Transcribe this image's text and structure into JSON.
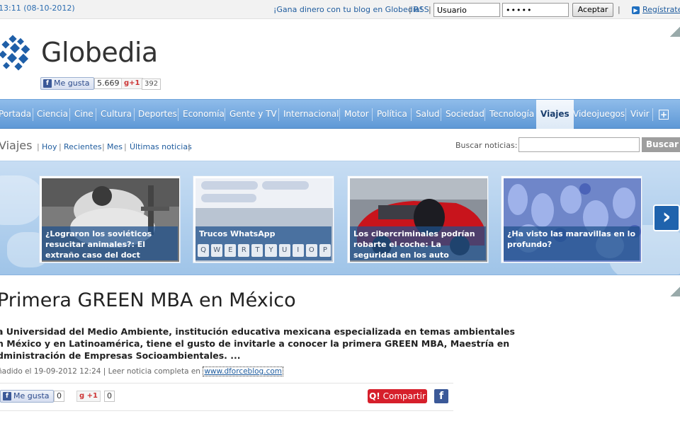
{
  "topbar": {
    "time": "13:11 (08-10-2012)",
    "promo": "¡Gana dinero con tu blog en Globedia!",
    "rss": "RSS",
    "user_value": "Usuario",
    "password_value": "•••••",
    "accept_label": "Aceptar",
    "register_label": "Regístrate"
  },
  "header": {
    "logo_text": "Globedia",
    "fb_like_label": "Me gusta",
    "fb_count": "5.669",
    "gplus_label": "+1",
    "gplus_count": "392"
  },
  "nav": {
    "items": [
      "Portada",
      "Ciencia",
      "Cine",
      "Cultura",
      "Deportes",
      "Economía",
      "Gente y TV",
      "Internacional",
      "Motor",
      "Política",
      "Salud",
      "Sociedad",
      "Tecnología",
      "Viajes",
      "Videojuegos",
      "Vivir"
    ],
    "active": "Viajes",
    "plus": "+"
  },
  "subbar": {
    "section": "Viajes",
    "links": [
      "Hoy",
      "Recientes",
      "Mes",
      "Últimas noticias"
    ],
    "search_label": "Buscar noticias:",
    "search_button": "Buscar"
  },
  "carousel": {
    "cards": [
      {
        "caption": "¿Lograron los soviéticos resucitar animales?: El extraño caso del doct"
      },
      {
        "caption": "Trucos WhatsApp"
      },
      {
        "caption": "Los cibercriminales podrían robarte el coche: La seguridad en los auto"
      },
      {
        "caption": "¿Ha visto las maravillas en lo profundo?"
      }
    ],
    "keyboard_keys": [
      "Q",
      "W",
      "E",
      "R",
      "T",
      "Y",
      "U",
      "I",
      "O",
      "P"
    ],
    "next_arrow": "›"
  },
  "article": {
    "title": "Primera GREEN MBA en México",
    "body_lines": [
      "a Universidad del Medio Ambiente, institución educativa mexicana especializada en temas ambientales",
      "n México y en Latinoamérica, tiene el gusto de invitarle a conocer la primera GREEN MBA, Maestría en",
      "dministración de Empresas Socioambientales. ..."
    ],
    "meta_prefix": "ñadido el 19-09-2012 12:24",
    "meta_read": "Leer noticia completa en",
    "meta_link": "www.dforceblog.com",
    "fb_like_label": "Me gusta",
    "fb_count": "0",
    "gplus_label": "+1",
    "gplus_count": "0",
    "share_label": "Compartir"
  }
}
